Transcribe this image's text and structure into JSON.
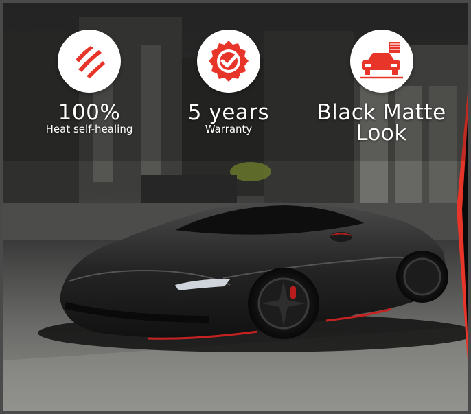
{
  "features": [
    {
      "icon": "scratch-marks-icon",
      "headline": "100%",
      "caption": "Heat self-healing"
    },
    {
      "icon": "check-seal-icon",
      "headline": "5 years",
      "caption": "Warranty"
    },
    {
      "icon": "car-matte-icon",
      "headline": "Black Matte Look",
      "caption": ""
    }
  ],
  "colors": {
    "accent": "#e8352a",
    "badge_bg": "#ffffff",
    "text": "#ffffff"
  }
}
